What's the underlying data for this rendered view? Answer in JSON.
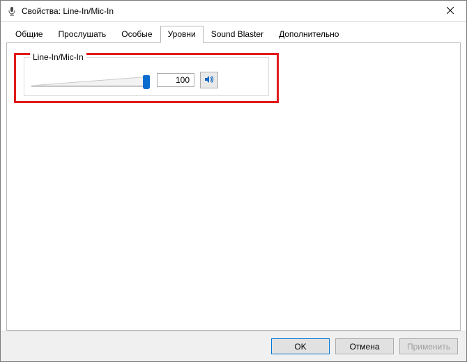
{
  "window": {
    "title": "Свойства: Line-In/Mic-In"
  },
  "tabs": [
    {
      "label": "Общие",
      "active": false
    },
    {
      "label": "Прослушать",
      "active": false
    },
    {
      "label": "Особые",
      "active": false
    },
    {
      "label": "Уровни",
      "active": true
    },
    {
      "label": "Sound Blaster",
      "active": false
    },
    {
      "label": "Дополнительно",
      "active": false
    }
  ],
  "level": {
    "group_label": "Line-In/Mic-In",
    "value": "100",
    "slider_pct": 100,
    "muted": false
  },
  "buttons": {
    "ok": "OK",
    "cancel": "Отмена",
    "apply": "Применить"
  }
}
